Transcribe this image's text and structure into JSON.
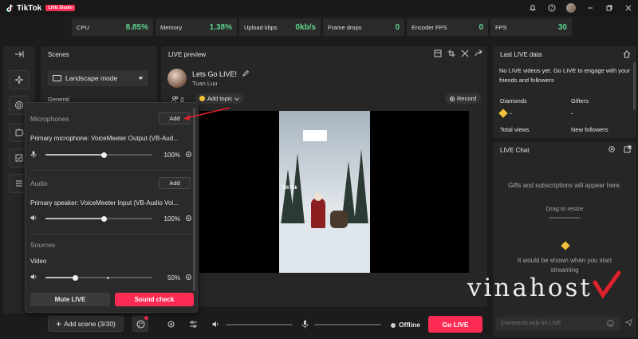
{
  "app": {
    "name": "TikTok",
    "badge": "LIVE Studio"
  },
  "stats": [
    {
      "label": "CPU",
      "value": "8.85%",
      "color": "#5fd68c"
    },
    {
      "label": "Memory",
      "value": "1.38%",
      "color": "#5fd68c"
    },
    {
      "label": "Upload kbps",
      "value": "0kb/s",
      "color": "#5fd68c"
    },
    {
      "label": "Frame drops",
      "value": "0",
      "color": "#5fd68c"
    },
    {
      "label": "Encoder FPS",
      "value": "0",
      "color": "#5fd68c"
    },
    {
      "label": "FPS",
      "value": "30",
      "color": "#5fd68c"
    }
  ],
  "scenes": {
    "title": "Scenes",
    "mode": "Landscape mode",
    "group": "General",
    "add_scene": "Add scene (3/30)"
  },
  "popup": {
    "microphones": {
      "title": "Microphones",
      "add": "Add",
      "device": "Primary microphone: VoiceMeeter Output (VB-Aud...",
      "volume": "100%",
      "level": 0.55
    },
    "audio": {
      "title": "Audio",
      "add": "Add",
      "device": "Primary speaker: VoiceMeeter Input (VB-Audio Voi...",
      "volume": "100%",
      "level": 0.55
    },
    "sources": {
      "title": "Sources",
      "item": "Video",
      "volume": "50%",
      "level": 0.28
    },
    "mute_live": "Mute LIVE",
    "sound_check": "Sound check"
  },
  "preview": {
    "title": "LIVE preview",
    "live_title": "Lets Go LIVE!",
    "host": "Tuan Luu",
    "viewers": "0",
    "add_topic": "Add topic",
    "record": "Record",
    "watermark": "TikTok"
  },
  "bottom": {
    "status": "Offline",
    "go_live": "Go LIVE"
  },
  "last_live": {
    "title": "Last LIVE data",
    "message": "No LIVE videos yet.  Go LIVE to engage with your friends and followers",
    "diamonds_label": "Diamonds",
    "diamonds_value": "-",
    "gifters_label": "Gifters",
    "gifters_value": "-",
    "views_label": "Total views",
    "followers_label": "New followers"
  },
  "live_chat": {
    "title": "LIVE Chat",
    "gifts_msg": "Gifts and subscriptions will appear here.",
    "drag": "Drag to resize",
    "empty_line1": "It would be shown when you start",
    "empty_line2": "streaming",
    "input_placeholder": "Comments only on LIVE"
  },
  "watermark": {
    "text": "vinahost"
  },
  "colors": {
    "accent": "#fe2c55",
    "good": "#5fd68c",
    "panel": "#262626"
  }
}
